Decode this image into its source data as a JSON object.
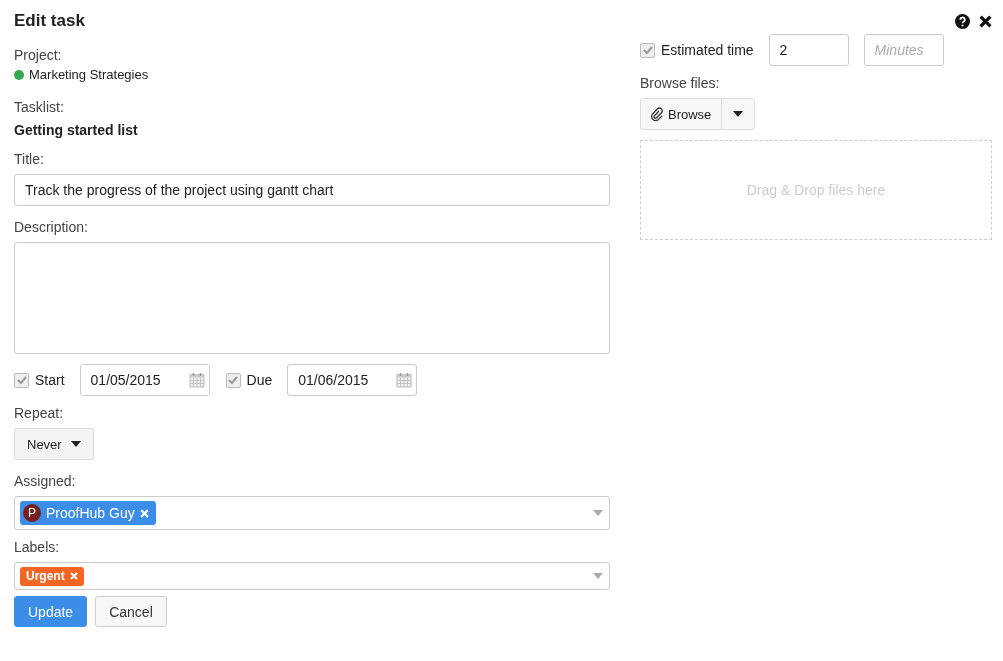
{
  "dialog": {
    "title": "Edit task"
  },
  "project": {
    "label": "Project:",
    "name": "Marketing Strategies",
    "color": "#34a853"
  },
  "tasklist": {
    "label": "Tasklist:",
    "name": "Getting started list"
  },
  "title_field": {
    "label": "Title:",
    "value": "Track the progress of the project using gantt chart"
  },
  "description": {
    "label": "Description:"
  },
  "dates": [
    {
      "label": "Start",
      "checked": true,
      "value": "01/05/2015"
    },
    {
      "label": "Due",
      "checked": true,
      "value": "01/06/2015"
    }
  ],
  "repeat": {
    "label": "Repeat:",
    "value": "Never"
  },
  "assigned": {
    "label": "Assigned:",
    "people": [
      {
        "initial": "P",
        "name": "ProofHub Guy"
      }
    ]
  },
  "labels": {
    "label": "Labels:",
    "tags": [
      {
        "name": "Urgent",
        "color": "#f26522"
      }
    ]
  },
  "buttons": [
    {
      "label": "Update",
      "kind": "primary"
    },
    {
      "label": "Cancel",
      "kind": "secondary"
    }
  ],
  "estimated_time": {
    "label": "Estimated time",
    "checked": true,
    "value": "2",
    "unit_placeholder": "Minutes"
  },
  "files": {
    "label": "Browse files:",
    "button": "Browse",
    "dropzone": "Drag & Drop files here"
  }
}
